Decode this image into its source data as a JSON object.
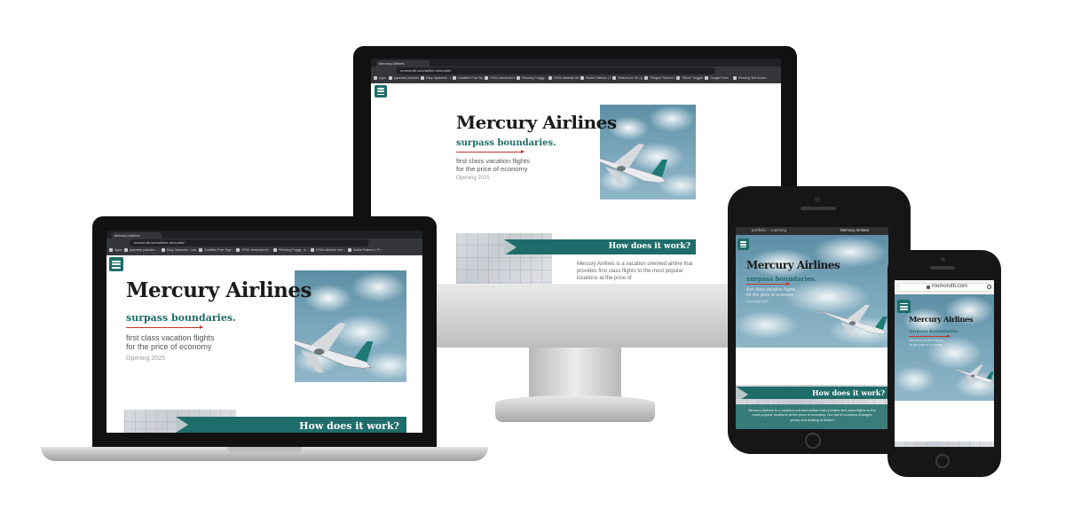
{
  "site": {
    "brand": "Mercury Airlines",
    "tagline": "surpass boundaries.",
    "subtitle_line1": "first class vacation flights",
    "subtitle_line2": "for the price of economy",
    "opening": "Opening 2025",
    "how_title": "How does it work?",
    "desc_desktop": "Mercury Airlines is a vacation oriented airline that provides first class flights to the most popular locations at the price of",
    "desc_tablet": "Mercury Airlines is a vacation oriented airline that provides first class flights to the most popular locations at the price of economy. Our list of locations changes yearly and seating is limited"
  },
  "browser": {
    "tab_title": "Mercury Airlines",
    "url": "momoroth.com/airline-microsite/",
    "bookmarks": [
      "Apps",
      "japanese particles -...",
      "Easy Japanese - Lea...",
      "Godaffen Free Sign...",
      "HTML elements ref...",
      "Phishing Froggy - A...",
      "HTML attribute refe...",
      "Subtle Patterns | Fr...",
      "Textures for 3D, gra...",
      "\"Dragon\" Names for...",
      "\"Mimic\" Suggesti...",
      "Google Fonts",
      "Reading Text Acces..."
    ],
    "bookmarks_laptop": [
      "Apps",
      "japanese particles -...",
      "Easy Japanese - Lea...",
      "Godaffen Free Sign...",
      "HTML elements ref...",
      "Phishing Froggy - A...",
      "HTML attribute refe...",
      "Subtle Patterns | Fr..."
    ],
    "tablet_tab": "portfolio – coaching",
    "tablet_title": "Mercury Airlines",
    "phone_url": "momoroth.com"
  },
  "colors": {
    "accent": "#1f6d6a",
    "red_line": "#c0392b",
    "brand_text": "#1b1b1b"
  },
  "icons": [
    "menu-icon",
    "plane-icon",
    "lock-icon",
    "refresh-icon"
  ]
}
